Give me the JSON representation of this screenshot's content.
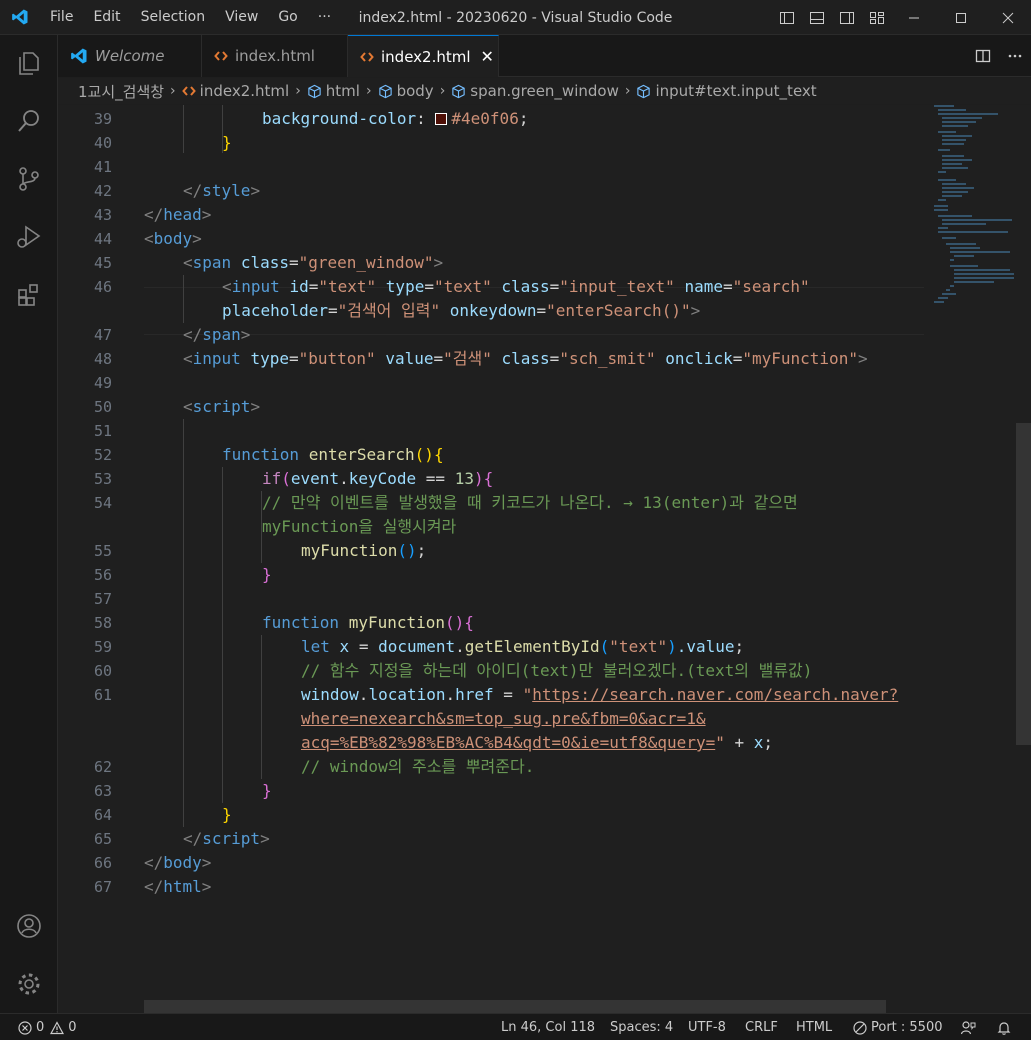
{
  "titlebar": {
    "menu": [
      "File",
      "Edit",
      "Selection",
      "View",
      "Go",
      "···"
    ],
    "title": "index2.html - 20230620 - Visual Studio Code"
  },
  "tabs": [
    {
      "label": "Welcome",
      "icon": "vscode-icon"
    },
    {
      "label": "index.html",
      "icon": "html-icon"
    },
    {
      "label": "index2.html",
      "icon": "html-icon",
      "active": true
    }
  ],
  "breadcrumb": [
    "1교시_검색창",
    "index2.html",
    "html",
    "body",
    "span.green_window",
    "input#text.input_text"
  ],
  "gutter": [
    "39",
    "40",
    "41",
    "42",
    "43",
    "44",
    "45",
    "46",
    "",
    "47",
    "48",
    "49",
    "50",
    "51",
    "52",
    "53",
    "54",
    "",
    "55",
    "56",
    "57",
    "58",
    "59",
    "60",
    "61",
    "",
    "",
    "62",
    "63",
    "64",
    "65",
    "66",
    "67"
  ],
  "code": {
    "l39_prop": "background-color",
    "l39_colon": ": ",
    "l39_val": "#4e0f06",
    "l39_semi": ";",
    "l40": "}",
    "l42_open": "</",
    "l42_tag": "style",
    "l42_close": ">",
    "l43_open": "</",
    "l43_tag": "head",
    "l43_close": ">",
    "l44_open": "<",
    "l44_tag": "body",
    "l44_close": ">",
    "l45_open": "<",
    "l45_tag": "span",
    "l45_attr": "class",
    "l45_val": "\"green_window\"",
    "l45_close": ">",
    "l46_open": "<",
    "l46_tag": "input",
    "l46_a1": "id",
    "l46_v1": "\"text\"",
    "l46_a2": "type",
    "l46_v2": "\"text\"",
    "l46_a3": "class",
    "l46_v3": "\"input_text\"",
    "l46_a4": "name",
    "l46_v4": "\"search\"",
    "l46b_a1": "placeholder",
    "l46b_v1": "\"검색어 입력\"",
    "l46b_a2": "onkeydown",
    "l46b_v2": "\"enterSearch()\"",
    "l46b_close": ">",
    "l47_open": "</",
    "l47_tag": "span",
    "l47_close": ">",
    "l48_open": "<",
    "l48_tag": "input",
    "l48_a1": "type",
    "l48_v1": "\"button\"",
    "l48_a2": "value",
    "l48_v2": "\"검색\"",
    "l48_a3": "class",
    "l48_v3": "\"sch_smit\"",
    "l48_a4": "onclick",
    "l48_v4": "\"myFunction\"",
    "l48_close": ">",
    "l50_open": "<",
    "l50_tag": "script",
    "l50_close": ">",
    "l52_kw": "function",
    "l52_fn": "enterSearch",
    "l52_p": "()",
    "l52_b": "{",
    "l53_kw": "if",
    "l53_p1": "(",
    "l53_var": "event",
    "l53_dot": ".",
    "l53_prop": "keyCode",
    "l53_op": " == ",
    "l53_num": "13",
    "l53_p2": ")",
    "l53_b": "{",
    "l54_c1": "// 만약 이벤트를 발생했을 때 키코드가 나온다. → 13(enter)과 같으면",
    "l54_c2": "myFunction을 실행시켜라",
    "l55_fn": "myFunction",
    "l55_p": "()",
    "l55_semi": ";",
    "l56": "}",
    "l58_kw": "function",
    "l58_fn": "myFunction",
    "l58_p": "()",
    "l58_b": "{",
    "l59_kw": "let",
    "l59_var": "x",
    "l59_eq": " = ",
    "l59_obj": "document",
    "l59_dot": ".",
    "l59_fn": "getElementById",
    "l59_p1": "(",
    "l59_str": "\"text\"",
    "l59_p2": ")",
    "l59_prop": ".value",
    "l59_semi": ";",
    "l60_c": "// 함수 지정을 하는데 아이디(text)만 불러오겠다.(text의 밸류값)",
    "l61_obj": "window",
    "l61_dot1": ".",
    "l61_p1": "location",
    "l61_dot2": ".",
    "l61_p2": "href",
    "l61_eq": " = ",
    "l61_q": "\"",
    "l61_url1": "https://search.naver.com/search.naver?",
    "l61_url2": "where=nexearch&sm=top_sug.pre&fbm=0&acr=1&",
    "l61_url3": "acq=%EB%82%98%EB%AC%B4&qdt=0&ie=utf8&query=",
    "l61_q2": "\"",
    "l61_plus": " + ",
    "l61_x": "x",
    "l61_semi": ";",
    "l62_c": "// window의 주소를 뿌려준다.",
    "l63": "}",
    "l64": "}",
    "l65_open": "</",
    "l65_tag": "script",
    "l65_close": ">",
    "l66_open": "</",
    "l66_tag": "body",
    "l66_close": ">",
    "l67_open": "</",
    "l67_tag": "html",
    "l67_close": ">"
  },
  "statusbar": {
    "errors": "0",
    "warnings": "0",
    "position": "Ln 46, Col 118",
    "spaces": "Spaces: 4",
    "encoding": "UTF-8",
    "eol": "CRLF",
    "language": "HTML",
    "port": "Port : 5500"
  },
  "colors": {
    "accent": "#0078d4",
    "vscode_blue": "#23a9f2",
    "html_icon": "#e37933",
    "swatch": "#4e0f06"
  }
}
